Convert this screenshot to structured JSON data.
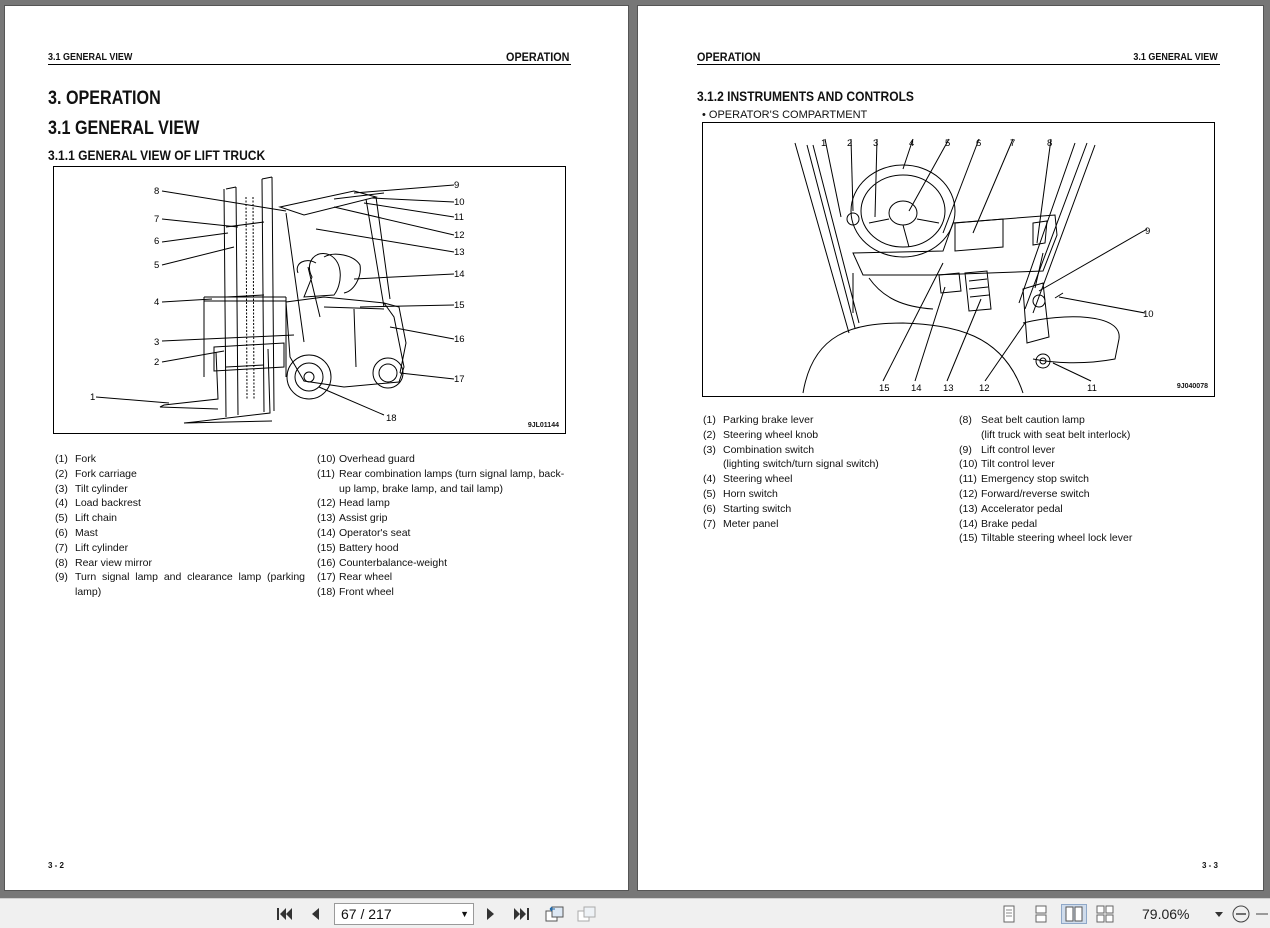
{
  "left_page": {
    "header_left": "3.1 GENERAL VIEW",
    "header_right": "OPERATION",
    "chapter_title": "3. OPERATION",
    "section_title": "3.1 GENERAL VIEW",
    "subsection_title": "3.1.1 GENERAL VIEW OF LIFT TRUCK",
    "figure_id": "9JL01144",
    "callouts": [
      "1",
      "2",
      "3",
      "4",
      "5",
      "6",
      "7",
      "8",
      "9",
      "10",
      "11",
      "12",
      "13",
      "14",
      "15",
      "16",
      "17",
      "18"
    ],
    "legend_col1": [
      {
        "n": "(1)",
        "t": "Fork"
      },
      {
        "n": "(2)",
        "t": "Fork carriage"
      },
      {
        "n": "(3)",
        "t": "Tilt cylinder"
      },
      {
        "n": "(4)",
        "t": "Load backrest"
      },
      {
        "n": "(5)",
        "t": "Lift chain"
      },
      {
        "n": "(6)",
        "t": "Mast"
      },
      {
        "n": "(7)",
        "t": "Lift cylinder"
      },
      {
        "n": "(8)",
        "t": "Rear view mirror"
      },
      {
        "n": "(9)",
        "t": "Turn signal lamp and clearance lamp (parking lamp)"
      }
    ],
    "legend_col2": [
      {
        "n": "(10)",
        "t": "Overhead guard"
      },
      {
        "n": "(11)",
        "t": "Rear combination lamps (turn signal lamp, back-up lamp, brake lamp, and tail lamp)"
      },
      {
        "n": "(12)",
        "t": "Head lamp"
      },
      {
        "n": "(13)",
        "t": "Assist grip"
      },
      {
        "n": "(14)",
        "t": "Operator's seat"
      },
      {
        "n": "(15)",
        "t": "Battery hood"
      },
      {
        "n": "(16)",
        "t": "Counterbalance-weight"
      },
      {
        "n": "(17)",
        "t": "Rear wheel"
      },
      {
        "n": "(18)",
        "t": "Front wheel"
      }
    ],
    "page_number": "3 - 2"
  },
  "right_page": {
    "header_left": "OPERATION",
    "header_right": "3.1 GENERAL VIEW",
    "subsection_title": "3.1.2 INSTRUMENTS AND CONTROLS",
    "subheading": "• OPERATOR'S COMPARTMENT",
    "figure_id": "9J040078",
    "callouts": [
      "1",
      "2",
      "3",
      "4",
      "5",
      "6",
      "7",
      "8",
      "9",
      "10",
      "11",
      "12",
      "13",
      "14",
      "15"
    ],
    "legend_col1": [
      {
        "n": "(1)",
        "t": "Parking brake lever"
      },
      {
        "n": "(2)",
        "t": "Steering wheel knob"
      },
      {
        "n": "(3)",
        "t": "Combination switch"
      },
      {
        "n": "",
        "t": "(lighting switch/turn signal switch)"
      },
      {
        "n": "(4)",
        "t": "Steering wheel"
      },
      {
        "n": "(5)",
        "t": "Horn switch"
      },
      {
        "n": "(6)",
        "t": "Starting switch"
      },
      {
        "n": "(7)",
        "t": "Meter panel"
      }
    ],
    "legend_col2": [
      {
        "n": "(8)",
        "t": "Seat belt caution lamp"
      },
      {
        "n": "",
        "t": "(lift truck with seat belt interlock)"
      },
      {
        "n": "(9)",
        "t": "Lift control lever"
      },
      {
        "n": "(10)",
        "t": "Tilt control lever"
      },
      {
        "n": "(11)",
        "t": "Emergency stop switch"
      },
      {
        "n": "(12)",
        "t": "Forward/reverse switch"
      },
      {
        "n": "(13)",
        "t": "Accelerator pedal"
      },
      {
        "n": "(14)",
        "t": "Brake pedal"
      },
      {
        "n": "(15)",
        "t": "Tiltable steering wheel lock lever"
      }
    ],
    "page_number": "3 - 3"
  },
  "toolbar": {
    "page_field": "67 / 217",
    "zoom": "79.06%",
    "icons": [
      "first-page-icon",
      "previous-page-icon",
      "next-page-icon",
      "last-page-icon",
      "previous-view-icon",
      "next-view-icon",
      "single-page-icon",
      "continuous-icon",
      "facing-icon",
      "continuous-facing-icon",
      "zoom-out-icon"
    ]
  }
}
